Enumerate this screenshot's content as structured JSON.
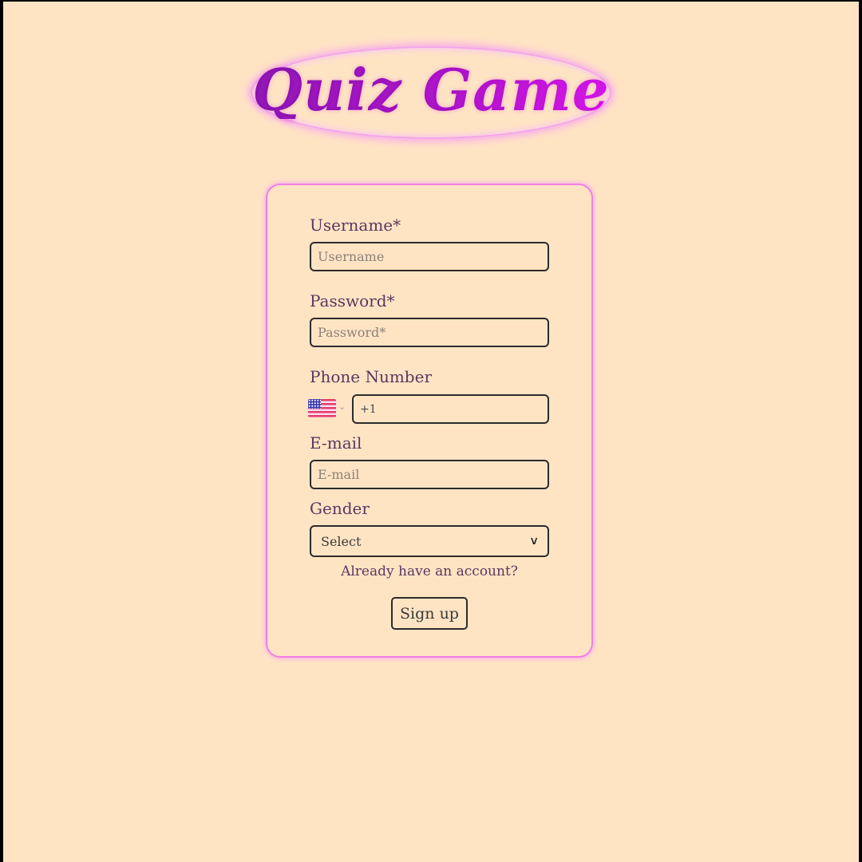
{
  "app": {
    "title": "Quiz Game"
  },
  "form": {
    "username": {
      "label": "Username*",
      "placeholder": "Username",
      "value": ""
    },
    "password": {
      "label": "Password*",
      "placeholder": "Password*",
      "value": ""
    },
    "phone": {
      "label": "Phone Number",
      "country_flag": "us-flag-icon",
      "value": "+1"
    },
    "email": {
      "label": "E-mail",
      "placeholder": "E-mail",
      "value": ""
    },
    "gender": {
      "label": "Gender",
      "selected": "Select"
    },
    "account_link": "Already have an account?",
    "signup_label": "Sign up"
  },
  "colors": {
    "page_background": "#ffe4c4",
    "accent_pink": "#f07ee6",
    "title_gradient_start": "#6e0e9e",
    "title_gradient_end": "#d10de8",
    "label_text": "#5a3760"
  }
}
